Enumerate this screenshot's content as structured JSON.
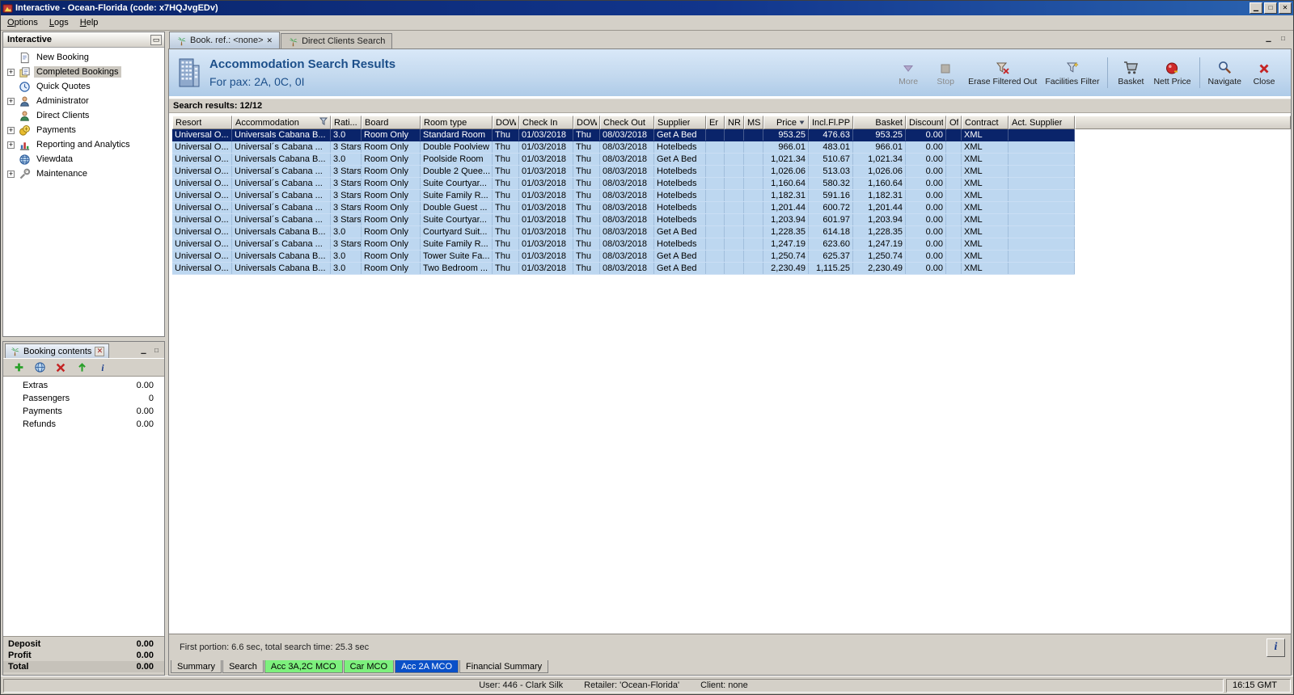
{
  "window": {
    "title": "Interactive - Ocean-Florida (code: x7HQJvgEDv)"
  },
  "menu": {
    "items": [
      "Options",
      "Logs",
      "Help"
    ]
  },
  "sidebar": {
    "title": "Interactive",
    "items": [
      {
        "label": "New Booking",
        "icon": "new-booking-icon",
        "expandable": false,
        "selected": false
      },
      {
        "label": "Completed Bookings",
        "icon": "completed-bookings-icon",
        "expandable": true,
        "selected": true
      },
      {
        "label": "Quick Quotes",
        "icon": "quick-quotes-icon",
        "expandable": false,
        "selected": false
      },
      {
        "label": "Administrator",
        "icon": "administrator-icon",
        "expandable": true,
        "selected": false
      },
      {
        "label": "Direct Clients",
        "icon": "direct-clients-icon",
        "expandable": false,
        "selected": false
      },
      {
        "label": "Payments",
        "icon": "payments-icon",
        "expandable": true,
        "selected": false
      },
      {
        "label": "Reporting and Analytics",
        "icon": "reporting-icon",
        "expandable": true,
        "selected": false
      },
      {
        "label": "Viewdata",
        "icon": "viewdata-icon",
        "expandable": false,
        "selected": false
      },
      {
        "label": "Maintenance",
        "icon": "maintenance-icon",
        "expandable": true,
        "selected": false
      }
    ]
  },
  "booking_contents": {
    "tab_title": "Booking contents",
    "toolbar_icons": [
      "add-icon",
      "globe-icon",
      "delete-icon",
      "up-icon",
      "info-icon"
    ],
    "rows": [
      {
        "label": "Extras",
        "value": "0.00"
      },
      {
        "label": "Passengers",
        "value": "0"
      },
      {
        "label": "Payments",
        "value": "0.00"
      },
      {
        "label": "Refunds",
        "value": "0.00"
      }
    ],
    "summary": [
      {
        "label": "Deposit",
        "value": "0.00"
      },
      {
        "label": "Profit",
        "value": "0.00"
      },
      {
        "label": "Total",
        "value": "0.00"
      }
    ]
  },
  "main": {
    "tabs": [
      {
        "label": "Book. ref.: <none>",
        "icon": "palm-icon",
        "active": true,
        "closable": true
      },
      {
        "label": "Direct Clients Search",
        "icon": "palm-icon",
        "active": false,
        "closable": false
      }
    ],
    "header": {
      "title": "Accommodation Search Results",
      "subtitle": "For pax: 2A, 0C, 0I"
    },
    "toolbar_groups": [
      [
        {
          "label": "More",
          "icon": "more-icon",
          "disabled": true
        },
        {
          "label": "Stop",
          "icon": "stop-icon",
          "disabled": true
        },
        {
          "label": "Erase Filtered Out",
          "icon": "erase-filter-icon",
          "disabled": false
        },
        {
          "label": "Facilities Filter",
          "icon": "facilities-filter-icon",
          "disabled": false
        }
      ],
      [
        {
          "label": "Basket",
          "icon": "basket-icon",
          "disabled": false
        },
        {
          "label": "Nett Price",
          "icon": "nett-price-icon",
          "disabled": false
        }
      ],
      [
        {
          "label": "Navigate",
          "icon": "navigate-icon",
          "disabled": false
        },
        {
          "label": "Close",
          "icon": "close-icon",
          "disabled": false
        }
      ]
    ],
    "results_label": "Search results: 12/12",
    "status_line": "First portion: 6.6 sec, total search time: 25.3 sec",
    "bottom_tabs": [
      {
        "label": "Summary",
        "style": "plain"
      },
      {
        "label": "Search",
        "style": "plain"
      },
      {
        "label": "Acc 3A,2C MCO",
        "style": "green"
      },
      {
        "label": "Car MCO",
        "style": "green"
      },
      {
        "label": "Acc 2A MCO",
        "style": "selected"
      },
      {
        "label": "Financial Summary",
        "style": "plain"
      }
    ]
  },
  "table": {
    "columns": [
      "Resort",
      "Accommodation",
      "Rati...",
      "Board",
      "Room type",
      "DOW",
      "Check In",
      "DOW",
      "Check Out",
      "Supplier",
      "Er",
      "NR",
      "MS",
      "Price",
      "Incl.Fl.PP",
      "Basket",
      "Discount",
      "Of",
      "Contract",
      "Act. Supplier"
    ],
    "filter_column": "Accommodation",
    "sorted_column": "Price",
    "rows": [
      {
        "selected": true,
        "cells": [
          "Universal O...",
          "Universals Cabana B...",
          "3.0",
          "Room Only",
          "Standard Room",
          "Thu",
          "01/03/2018",
          "Thu",
          "08/03/2018",
          "Get A Bed",
          "",
          "",
          "",
          "953.25",
          "476.63",
          "953.25",
          "0.00",
          "",
          "XML",
          ""
        ]
      },
      {
        "selected": false,
        "cells": [
          "Universal O...",
          "Universal´s Cabana ...",
          "3 Stars",
          "Room Only",
          "Double Poolview",
          "Thu",
          "01/03/2018",
          "Thu",
          "08/03/2018",
          "Hotelbeds",
          "",
          "",
          "",
          "966.01",
          "483.01",
          "966.01",
          "0.00",
          "",
          "XML",
          ""
        ]
      },
      {
        "selected": false,
        "cells": [
          "Universal O...",
          "Universals Cabana B...",
          "3.0",
          "Room Only",
          "Poolside Room",
          "Thu",
          "01/03/2018",
          "Thu",
          "08/03/2018",
          "Get A Bed",
          "",
          "",
          "",
          "1,021.34",
          "510.67",
          "1,021.34",
          "0.00",
          "",
          "XML",
          ""
        ]
      },
      {
        "selected": false,
        "cells": [
          "Universal O...",
          "Universal´s Cabana ...",
          "3 Stars",
          "Room Only",
          "Double 2 Quee...",
          "Thu",
          "01/03/2018",
          "Thu",
          "08/03/2018",
          "Hotelbeds",
          "",
          "",
          "",
          "1,026.06",
          "513.03",
          "1,026.06",
          "0.00",
          "",
          "XML",
          ""
        ]
      },
      {
        "selected": false,
        "cells": [
          "Universal O...",
          "Universal´s Cabana ...",
          "3 Stars",
          "Room Only",
          "Suite Courtyar...",
          "Thu",
          "01/03/2018",
          "Thu",
          "08/03/2018",
          "Hotelbeds",
          "",
          "",
          "",
          "1,160.64",
          "580.32",
          "1,160.64",
          "0.00",
          "",
          "XML",
          ""
        ]
      },
      {
        "selected": false,
        "cells": [
          "Universal O...",
          "Universal´s Cabana ...",
          "3 Stars",
          "Room Only",
          "Suite Family R...",
          "Thu",
          "01/03/2018",
          "Thu",
          "08/03/2018",
          "Hotelbeds",
          "",
          "",
          "",
          "1,182.31",
          "591.16",
          "1,182.31",
          "0.00",
          "",
          "XML",
          ""
        ]
      },
      {
        "selected": false,
        "cells": [
          "Universal O...",
          "Universal´s Cabana ...",
          "3 Stars",
          "Room Only",
          "Double Guest ...",
          "Thu",
          "01/03/2018",
          "Thu",
          "08/03/2018",
          "Hotelbeds",
          "",
          "",
          "",
          "1,201.44",
          "600.72",
          "1,201.44",
          "0.00",
          "",
          "XML",
          ""
        ]
      },
      {
        "selected": false,
        "cells": [
          "Universal O...",
          "Universal´s Cabana ...",
          "3 Stars",
          "Room Only",
          "Suite Courtyar...",
          "Thu",
          "01/03/2018",
          "Thu",
          "08/03/2018",
          "Hotelbeds",
          "",
          "",
          "",
          "1,203.94",
          "601.97",
          "1,203.94",
          "0.00",
          "",
          "XML",
          ""
        ]
      },
      {
        "selected": false,
        "cells": [
          "Universal O...",
          "Universals Cabana B...",
          "3.0",
          "Room Only",
          "Courtyard Suit...",
          "Thu",
          "01/03/2018",
          "Thu",
          "08/03/2018",
          "Get A Bed",
          "",
          "",
          "",
          "1,228.35",
          "614.18",
          "1,228.35",
          "0.00",
          "",
          "XML",
          ""
        ]
      },
      {
        "selected": false,
        "cells": [
          "Universal O...",
          "Universal´s Cabana ...",
          "3 Stars",
          "Room Only",
          "Suite Family R...",
          "Thu",
          "01/03/2018",
          "Thu",
          "08/03/2018",
          "Hotelbeds",
          "",
          "",
          "",
          "1,247.19",
          "623.60",
          "1,247.19",
          "0.00",
          "",
          "XML",
          ""
        ]
      },
      {
        "selected": false,
        "cells": [
          "Universal O...",
          "Universals Cabana B...",
          "3.0",
          "Room Only",
          "Tower Suite Fa...",
          "Thu",
          "01/03/2018",
          "Thu",
          "08/03/2018",
          "Get A Bed",
          "",
          "",
          "",
          "1,250.74",
          "625.37",
          "1,250.74",
          "0.00",
          "",
          "XML",
          ""
        ]
      },
      {
        "selected": false,
        "cells": [
          "Universal O...",
          "Universals Cabana B...",
          "3.0",
          "Room Only",
          "Two Bedroom ...",
          "Thu",
          "01/03/2018",
          "Thu",
          "08/03/2018",
          "Get A Bed",
          "",
          "",
          "",
          "2,230.49",
          "1,115.25",
          "2,230.49",
          "0.00",
          "",
          "XML",
          ""
        ]
      }
    ]
  },
  "statusbar": {
    "user": "User: 446 - Clark Silk",
    "retailer": "Retailer: 'Ocean-Florida'",
    "client": "Client: none",
    "time": "16:15 GMT"
  },
  "colors": {
    "titlebar_start": "#0a246a",
    "titlebar_end": "#2a63b0",
    "row_blue": "#bdd7f0",
    "selected_navy": "#0a246a",
    "tab_green": "#7df07d",
    "tab_blue": "#0a50c8",
    "header_band": "#c2d8ee"
  }
}
